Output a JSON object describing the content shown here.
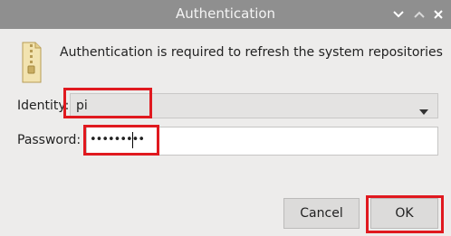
{
  "window": {
    "title": "Authentication",
    "controls": [
      "chevron-down-icon",
      "chevron-up-icon",
      "close-icon"
    ]
  },
  "dialog": {
    "icon": "zip-archive-icon",
    "message": "Authentication is required to refresh the system repositories",
    "identity_label": "Identity:",
    "identity_value": "pi",
    "password_label": "Password:",
    "password_value": "•••••••••",
    "cancel_label": "Cancel",
    "ok_label": "OK"
  },
  "colors": {
    "titlebar": "#8f8f8f",
    "highlight": "#e0191f",
    "background": "#edeceb"
  }
}
